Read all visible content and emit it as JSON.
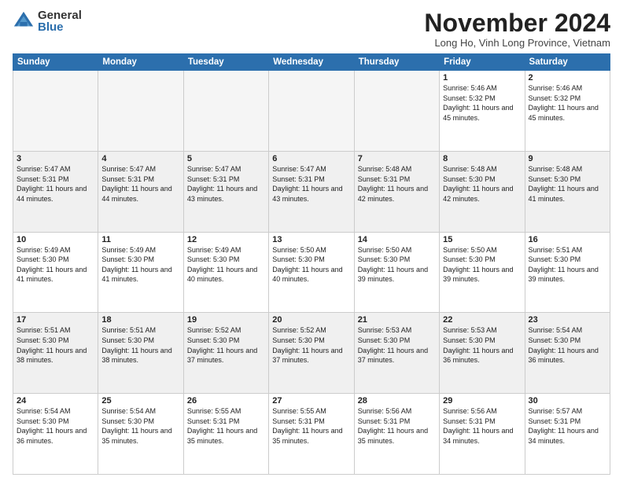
{
  "header": {
    "logo_general": "General",
    "logo_blue": "Blue",
    "month_title": "November 2024",
    "location": "Long Ho, Vinh Long Province, Vietnam"
  },
  "weekdays": [
    "Sunday",
    "Monday",
    "Tuesday",
    "Wednesday",
    "Thursday",
    "Friday",
    "Saturday"
  ],
  "weeks": [
    [
      {
        "day": "",
        "empty": true
      },
      {
        "day": "",
        "empty": true
      },
      {
        "day": "",
        "empty": true
      },
      {
        "day": "",
        "empty": true
      },
      {
        "day": "",
        "empty": true
      },
      {
        "day": "1",
        "sunrise": "5:46 AM",
        "sunset": "5:32 PM",
        "daylight": "11 hours and 45 minutes."
      },
      {
        "day": "2",
        "sunrise": "5:46 AM",
        "sunset": "5:32 PM",
        "daylight": "11 hours and 45 minutes."
      }
    ],
    [
      {
        "day": "3",
        "sunrise": "5:47 AM",
        "sunset": "5:31 PM",
        "daylight": "11 hours and 44 minutes."
      },
      {
        "day": "4",
        "sunrise": "5:47 AM",
        "sunset": "5:31 PM",
        "daylight": "11 hours and 44 minutes."
      },
      {
        "day": "5",
        "sunrise": "5:47 AM",
        "sunset": "5:31 PM",
        "daylight": "11 hours and 43 minutes."
      },
      {
        "day": "6",
        "sunrise": "5:47 AM",
        "sunset": "5:31 PM",
        "daylight": "11 hours and 43 minutes."
      },
      {
        "day": "7",
        "sunrise": "5:48 AM",
        "sunset": "5:31 PM",
        "daylight": "11 hours and 42 minutes."
      },
      {
        "day": "8",
        "sunrise": "5:48 AM",
        "sunset": "5:30 PM",
        "daylight": "11 hours and 42 minutes."
      },
      {
        "day": "9",
        "sunrise": "5:48 AM",
        "sunset": "5:30 PM",
        "daylight": "11 hours and 41 minutes."
      }
    ],
    [
      {
        "day": "10",
        "sunrise": "5:49 AM",
        "sunset": "5:30 PM",
        "daylight": "11 hours and 41 minutes."
      },
      {
        "day": "11",
        "sunrise": "5:49 AM",
        "sunset": "5:30 PM",
        "daylight": "11 hours and 41 minutes."
      },
      {
        "day": "12",
        "sunrise": "5:49 AM",
        "sunset": "5:30 PM",
        "daylight": "11 hours and 40 minutes."
      },
      {
        "day": "13",
        "sunrise": "5:50 AM",
        "sunset": "5:30 PM",
        "daylight": "11 hours and 40 minutes."
      },
      {
        "day": "14",
        "sunrise": "5:50 AM",
        "sunset": "5:30 PM",
        "daylight": "11 hours and 39 minutes."
      },
      {
        "day": "15",
        "sunrise": "5:50 AM",
        "sunset": "5:30 PM",
        "daylight": "11 hours and 39 minutes."
      },
      {
        "day": "16",
        "sunrise": "5:51 AM",
        "sunset": "5:30 PM",
        "daylight": "11 hours and 39 minutes."
      }
    ],
    [
      {
        "day": "17",
        "sunrise": "5:51 AM",
        "sunset": "5:30 PM",
        "daylight": "11 hours and 38 minutes."
      },
      {
        "day": "18",
        "sunrise": "5:51 AM",
        "sunset": "5:30 PM",
        "daylight": "11 hours and 38 minutes."
      },
      {
        "day": "19",
        "sunrise": "5:52 AM",
        "sunset": "5:30 PM",
        "daylight": "11 hours and 37 minutes."
      },
      {
        "day": "20",
        "sunrise": "5:52 AM",
        "sunset": "5:30 PM",
        "daylight": "11 hours and 37 minutes."
      },
      {
        "day": "21",
        "sunrise": "5:53 AM",
        "sunset": "5:30 PM",
        "daylight": "11 hours and 37 minutes."
      },
      {
        "day": "22",
        "sunrise": "5:53 AM",
        "sunset": "5:30 PM",
        "daylight": "11 hours and 36 minutes."
      },
      {
        "day": "23",
        "sunrise": "5:54 AM",
        "sunset": "5:30 PM",
        "daylight": "11 hours and 36 minutes."
      }
    ],
    [
      {
        "day": "24",
        "sunrise": "5:54 AM",
        "sunset": "5:30 PM",
        "daylight": "11 hours and 36 minutes."
      },
      {
        "day": "25",
        "sunrise": "5:54 AM",
        "sunset": "5:30 PM",
        "daylight": "11 hours and 35 minutes."
      },
      {
        "day": "26",
        "sunrise": "5:55 AM",
        "sunset": "5:31 PM",
        "daylight": "11 hours and 35 minutes."
      },
      {
        "day": "27",
        "sunrise": "5:55 AM",
        "sunset": "5:31 PM",
        "daylight": "11 hours and 35 minutes."
      },
      {
        "day": "28",
        "sunrise": "5:56 AM",
        "sunset": "5:31 PM",
        "daylight": "11 hours and 35 minutes."
      },
      {
        "day": "29",
        "sunrise": "5:56 AM",
        "sunset": "5:31 PM",
        "daylight": "11 hours and 34 minutes."
      },
      {
        "day": "30",
        "sunrise": "5:57 AM",
        "sunset": "5:31 PM",
        "daylight": "11 hours and 34 minutes."
      }
    ]
  ]
}
